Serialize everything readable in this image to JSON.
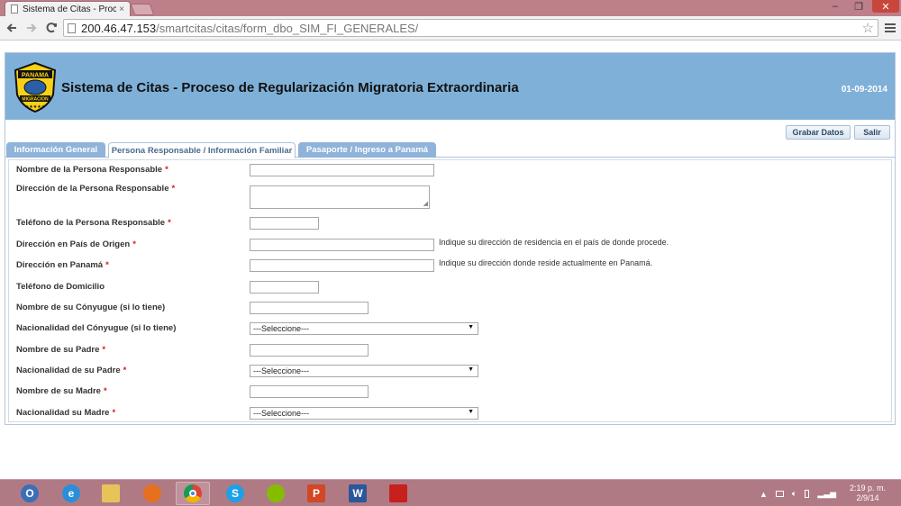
{
  "browser": {
    "tab_title": "Sistema de Citas - Proceso",
    "tab_close": "×",
    "url_host": "200.46.47.153",
    "url_path": "/smartcitas/citas/form_dbo_SIM_FI_GENERALES/",
    "window_controls": {
      "minimize": "–",
      "maximize": "❐",
      "close": "✕"
    }
  },
  "header": {
    "logo_top_text": "PANAMA",
    "logo_bottom_text": "MIGRACION",
    "title": "Sistema de Citas - Proceso de Regularización Migratoria Extraordinaria",
    "date": "01-09-2014"
  },
  "actions": {
    "save_label": "Grabar Datos",
    "exit_label": "Salir"
  },
  "tabs": [
    {
      "label": "Información General"
    },
    {
      "label": "Persona Responsable / Información Familiar"
    },
    {
      "label": "Pasaporte / Ingreso a Panamá"
    }
  ],
  "form": {
    "fields": [
      {
        "label": "Nombre de la Persona Responsable",
        "required": "*"
      },
      {
        "label": "Dirección de la Persona Responsable",
        "required": "*"
      },
      {
        "label": "Teléfono de la Persona Responsable",
        "required": "*"
      },
      {
        "label": "Dirección en País de Origen",
        "required": "*",
        "hint": "Indique su dirección de residencia en el país de donde procede."
      },
      {
        "label": "Dirección en Panamá",
        "required": "*",
        "hint": "Indique su dirección donde reside actualmente en Panamá."
      },
      {
        "label": "Teléfono de Domicilio",
        "required": ""
      },
      {
        "label": "Nombre de su Cónyugue (si lo tiene)",
        "required": ""
      },
      {
        "label": "Nacionalidad del Cónyugue (si lo tiene)",
        "required": "",
        "value": "---Seleccione---"
      },
      {
        "label": "Nombre de su Padre",
        "required": "*"
      },
      {
        "label": "Nacionalidad de su Padre",
        "required": "*",
        "value": "---Seleccione---"
      },
      {
        "label": "Nombre de su Madre",
        "required": "*"
      },
      {
        "label": "Nacionalidad su Madre",
        "required": "*",
        "value": "---Seleccione---"
      }
    ]
  },
  "taskbar": {
    "clock_time": "2:19 p. m.",
    "clock_date": "2/9/14",
    "tray_arrow": "▲",
    "apps": [
      "outlook",
      "internet-explorer",
      "file-explorer",
      "firefox",
      "chrome",
      "skype",
      "spotify",
      "powerpoint",
      "word",
      "acrobat"
    ]
  },
  "colors": {
    "header_bg": "#7fb0d8",
    "tab_inactive": "#8fb3da",
    "required": "#d02020",
    "taskbar": "#b07a85"
  }
}
